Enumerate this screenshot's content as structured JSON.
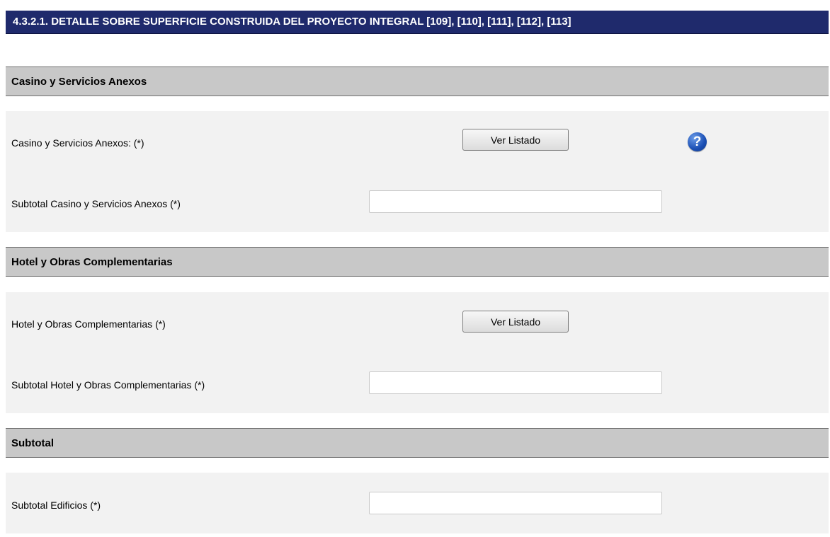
{
  "page_title": "4.3.2.1. DETALLE SOBRE SUPERFICIE CONSTRUIDA DEL PROYECTO INTEGRAL [109], [110], [111], [112], [113]",
  "sections": [
    {
      "title": "Casino y Servicios Anexos",
      "listing": {
        "label": "Casino y Servicios Anexos: (*)",
        "button_label": "Ver Listado",
        "help_icon": "question-circle-icon"
      },
      "subtotal": {
        "label": "Subtotal Casino y Servicios Anexos (*)",
        "value": ""
      }
    },
    {
      "title": "Hotel y Obras Complementarias",
      "listing": {
        "label": "Hotel y Obras Complementarias (*)",
        "button_label": "Ver Listado"
      },
      "subtotal": {
        "label": "Subtotal Hotel y Obras Complementarias (*)",
        "value": ""
      }
    },
    {
      "title": "Subtotal",
      "subtotal": {
        "label": "Subtotal Edificios (*)",
        "value": ""
      }
    }
  ],
  "colors": {
    "title_bar": "#1f2a6c",
    "section_header": "#c8c8c8",
    "row_background": "#f2f2f2",
    "help_icon": "#1b4fb4"
  }
}
